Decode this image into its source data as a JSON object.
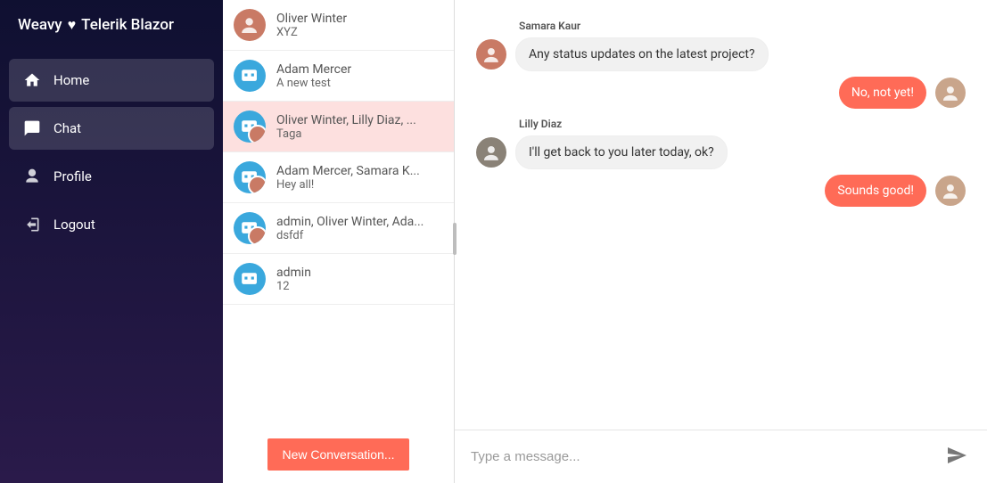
{
  "brand": {
    "left": "Weavy",
    "right": "Telerik Blazor"
  },
  "nav": {
    "home": "Home",
    "chat": "Chat",
    "profile": "Profile",
    "logout": "Logout"
  },
  "conversations": [
    {
      "title": "Oliver Winter",
      "sub": "XYZ",
      "avatar": "person1"
    },
    {
      "title": "Adam Mercer",
      "sub": "A new test",
      "avatar": "bot"
    },
    {
      "title": "Oliver Winter, Lilly Diaz, ...",
      "sub": "Taga",
      "avatar": "group",
      "selected": true
    },
    {
      "title": "Adam Mercer, Samara K...",
      "sub": "Hey all!",
      "avatar": "group"
    },
    {
      "title": "admin, Oliver Winter, Ada...",
      "sub": "dsfdf",
      "avatar": "group"
    },
    {
      "title": "admin",
      "sub": "12",
      "avatar": "bot"
    }
  ],
  "new_conversation_label": "New Conversation...",
  "messages": [
    {
      "author": "Samara Kaur",
      "text": "Any status updates on the latest project?",
      "dir": "in",
      "avatar": "person1"
    },
    {
      "text": "No, not yet!",
      "dir": "out",
      "avatar": "person3"
    },
    {
      "author": "Lilly Diaz",
      "text": "I'll get back to you later today, ok?",
      "dir": "in",
      "avatar": "person2"
    },
    {
      "text": "Sounds good!",
      "dir": "out",
      "avatar": "person3"
    }
  ],
  "composer": {
    "placeholder": "Type a message..."
  }
}
